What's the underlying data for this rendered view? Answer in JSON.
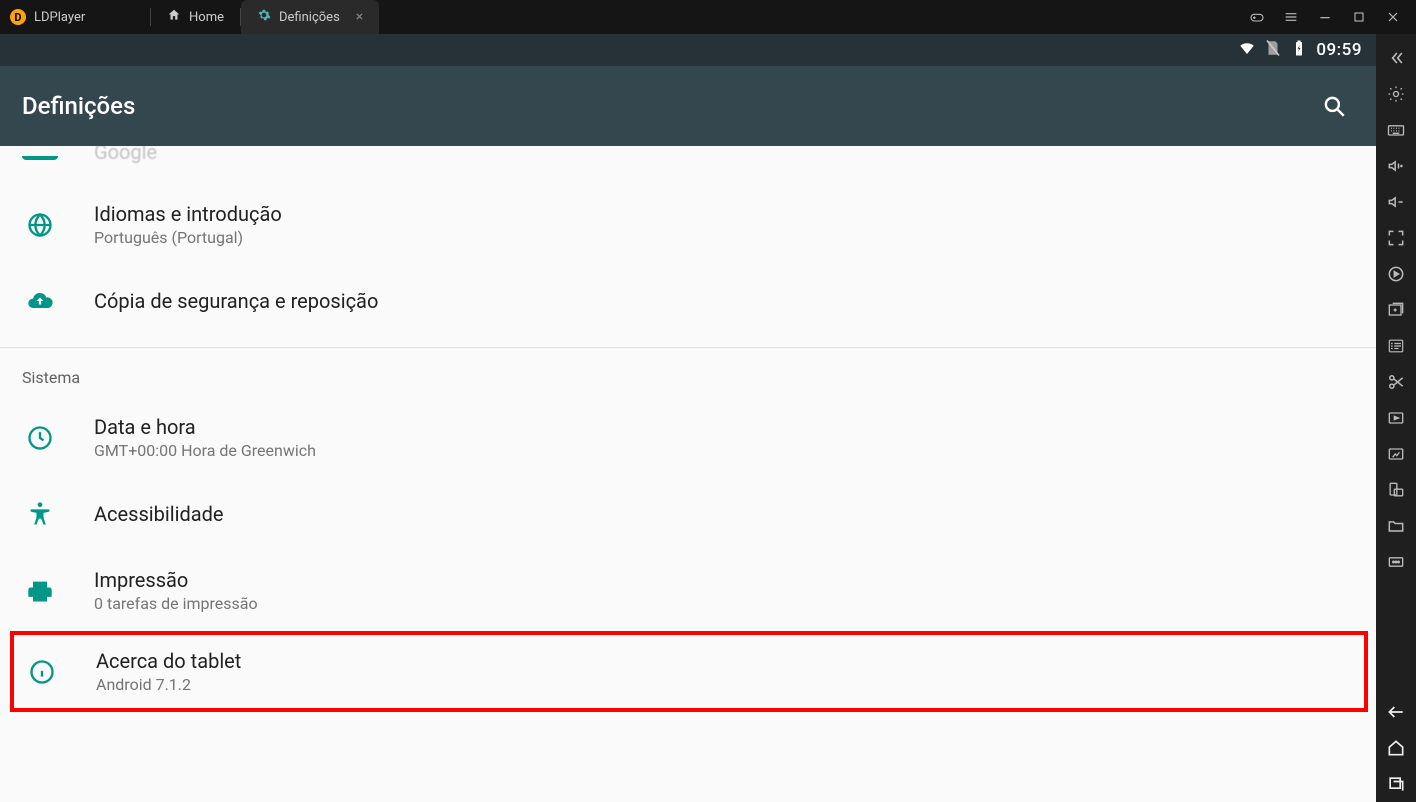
{
  "window": {
    "app_name": "LDPlayer",
    "tabs": [
      {
        "label": "Home",
        "active": false
      },
      {
        "label": "Definições",
        "active": true
      }
    ]
  },
  "status": {
    "clock": "09:59"
  },
  "appbar": {
    "title": "Definições"
  },
  "settings": {
    "partial_item": "Google",
    "items": [
      {
        "icon": "globe",
        "primary": "Idiomas e introdução",
        "secondary": "Português (Portugal)"
      },
      {
        "icon": "cloud-up",
        "primary": "Cópia de segurança e reposição",
        "secondary": ""
      }
    ],
    "section_header": "Sistema",
    "system_items": [
      {
        "icon": "clock",
        "primary": "Data e hora",
        "secondary": "GMT+00:00 Hora de Greenwich"
      },
      {
        "icon": "accessibility",
        "primary": "Acessibilidade",
        "secondary": ""
      },
      {
        "icon": "printer",
        "primary": "Impressão",
        "secondary": "0 tarefas de impressão"
      },
      {
        "icon": "info",
        "primary": "Acerca do tablet",
        "secondary": "Android 7.1.2",
        "highlight": true
      }
    ]
  }
}
